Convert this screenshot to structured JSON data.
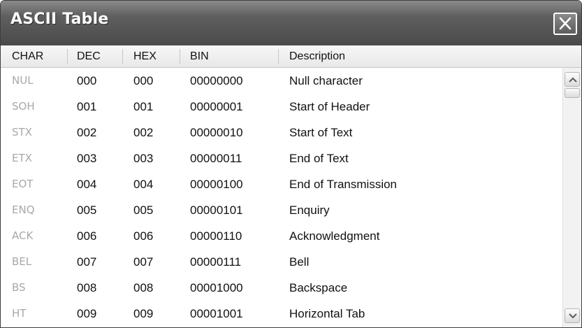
{
  "window": {
    "title": "ASCII Table",
    "close_icon": "close-icon"
  },
  "columns": [
    "CHAR",
    "DEC",
    "HEX",
    "BIN",
    "Description"
  ],
  "rows": [
    {
      "char": "NUL",
      "dec": "000",
      "hex": "000",
      "bin": "00000000",
      "desc": "Null character"
    },
    {
      "char": "SOH",
      "dec": "001",
      "hex": "001",
      "bin": "00000001",
      "desc": "Start of Header"
    },
    {
      "char": "STX",
      "dec": "002",
      "hex": "002",
      "bin": "00000010",
      "desc": "Start of Text"
    },
    {
      "char": "ETX",
      "dec": "003",
      "hex": "003",
      "bin": "00000011",
      "desc": "End of Text"
    },
    {
      "char": "EOT",
      "dec": "004",
      "hex": "004",
      "bin": "00000100",
      "desc": "End of Transmission"
    },
    {
      "char": "ENQ",
      "dec": "005",
      "hex": "005",
      "bin": "00000101",
      "desc": "Enquiry"
    },
    {
      "char": "ACK",
      "dec": "006",
      "hex": "006",
      "bin": "00000110",
      "desc": "Acknowledgment"
    },
    {
      "char": "BEL",
      "dec": "007",
      "hex": "007",
      "bin": "00000111",
      "desc": "Bell"
    },
    {
      "char": "BS",
      "dec": "008",
      "hex": "008",
      "bin": "00001000",
      "desc": "Backspace"
    },
    {
      "char": "HT",
      "dec": "009",
      "hex": "009",
      "bin": "00001001",
      "desc": "Horizontal Tab"
    }
  ],
  "colors": {
    "titlebar": "#5f5f5f",
    "char_text": "#a8a8a8",
    "text": "#111111"
  },
  "icons": {
    "scroll_up": "chevron-up-icon",
    "scroll_down": "chevron-down-icon"
  }
}
